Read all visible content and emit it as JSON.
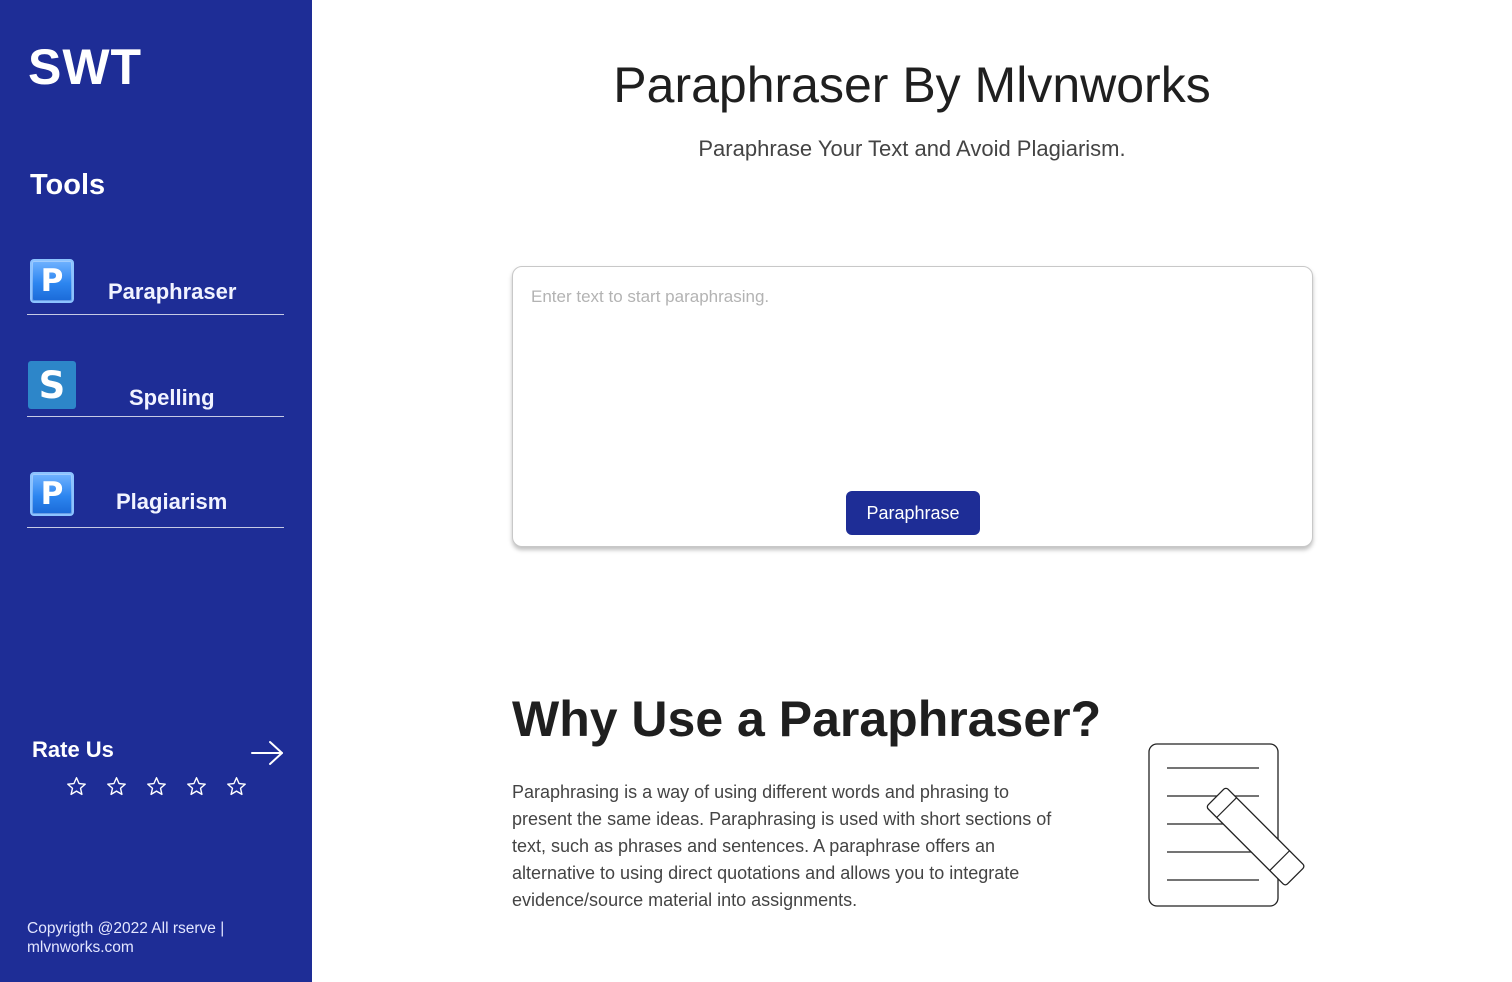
{
  "sidebar": {
    "brand": "SWT",
    "tools_title": "Tools",
    "items": [
      {
        "icon_letter": "P",
        "icon": "paraphraser-tile-icon",
        "label": "Paraphraser"
      },
      {
        "icon_letter": "S",
        "icon": "spelling-tile-icon",
        "label": "Spelling"
      },
      {
        "icon_letter": "P",
        "icon": "plagiarism-tile-icon",
        "label": "Plagiarism"
      }
    ],
    "rate": {
      "title": "Rate Us",
      "stars": 5,
      "rating": 0
    },
    "copyright": "Copyrigth @2022 All rserve | mlvnworks.com"
  },
  "main": {
    "title": "Paraphraser By Mlvnworks",
    "subtitle": "Paraphrase Your Text and Avoid Plagiarism.",
    "editor": {
      "value": "",
      "placeholder": "Enter text to start paraphrasing.",
      "button_label": "Paraphrase"
    },
    "why": {
      "title": "Why Use a Paraphraser?",
      "body": "Paraphrasing is a way of using different words and phrasing to present the same ideas. Paraphrasing is used with short sections of text, such as phrases and sentences. A paraphrase offers an alternative to using direct quotations and allows you to integrate evidence/source material into assignments."
    }
  },
  "colors": {
    "sidebar_bg": "#1e2d96",
    "accent": "#1e2d96",
    "tile_blue": "#2d86f0",
    "tile_s": "#2d86c9"
  }
}
